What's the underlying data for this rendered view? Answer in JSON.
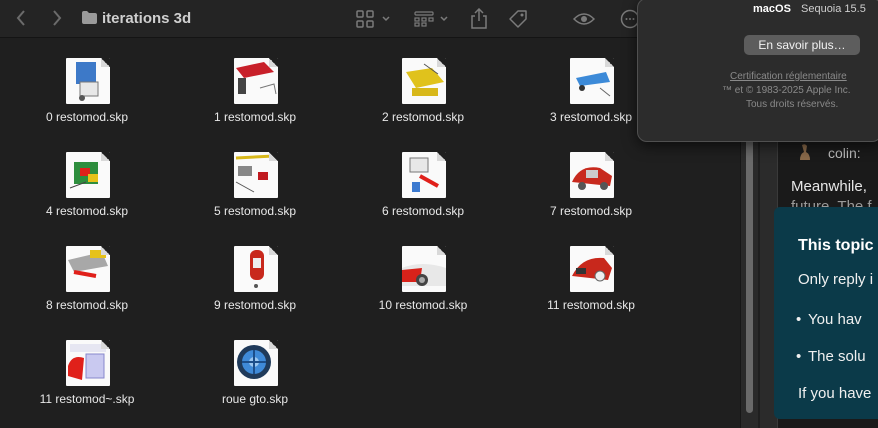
{
  "finder": {
    "title": "iterations 3d",
    "files": [
      {
        "name": "0 restomod.skp",
        "thumb": "car-chassis-blue"
      },
      {
        "name": "1 restomod.skp",
        "thumb": "car-red-parts"
      },
      {
        "name": "2 restomod.skp",
        "thumb": "car-yellow-parts"
      },
      {
        "name": "3 restomod.skp",
        "thumb": "car-blue-top"
      },
      {
        "name": "4 restomod.skp",
        "thumb": "car-engine-multi"
      },
      {
        "name": "5 restomod.skp",
        "thumb": "car-parts-yellow"
      },
      {
        "name": "6 restomod.skp",
        "thumb": "car-parts-red"
      },
      {
        "name": "7 restomod.skp",
        "thumb": "car-red-side"
      },
      {
        "name": "8 restomod.skp",
        "thumb": "car-yellow-front"
      },
      {
        "name": "9 restomod.skp",
        "thumb": "car-red-top"
      },
      {
        "name": "10 restomod.skp",
        "thumb": "car-red-wheel"
      },
      {
        "name": "11 restomod.skp",
        "thumb": "car-red-rear"
      },
      {
        "name": "11 restomod~.skp",
        "thumb": "car-red-body"
      },
      {
        "name": "roue gto.skp",
        "thumb": "wheel-blue"
      }
    ]
  },
  "about_mac": {
    "os_name": "macOS",
    "os_version": "Sequoia 15.5",
    "more_button": "En savoir plus…",
    "certification_link": "Certification réglementaire",
    "copyright": "™ et © 1983-2025 Apple Inc.",
    "rights": "Tous droits réservés."
  },
  "web": {
    "author": "colin:",
    "paragraph": "Meanwhile,",
    "paragraph_cut": "future. The f",
    "notice_title": "This topic",
    "notice_line1": "Only reply i",
    "notice_bullet1": "You hav",
    "notice_bullet2": "The solu",
    "notice_line4": "If you have"
  }
}
